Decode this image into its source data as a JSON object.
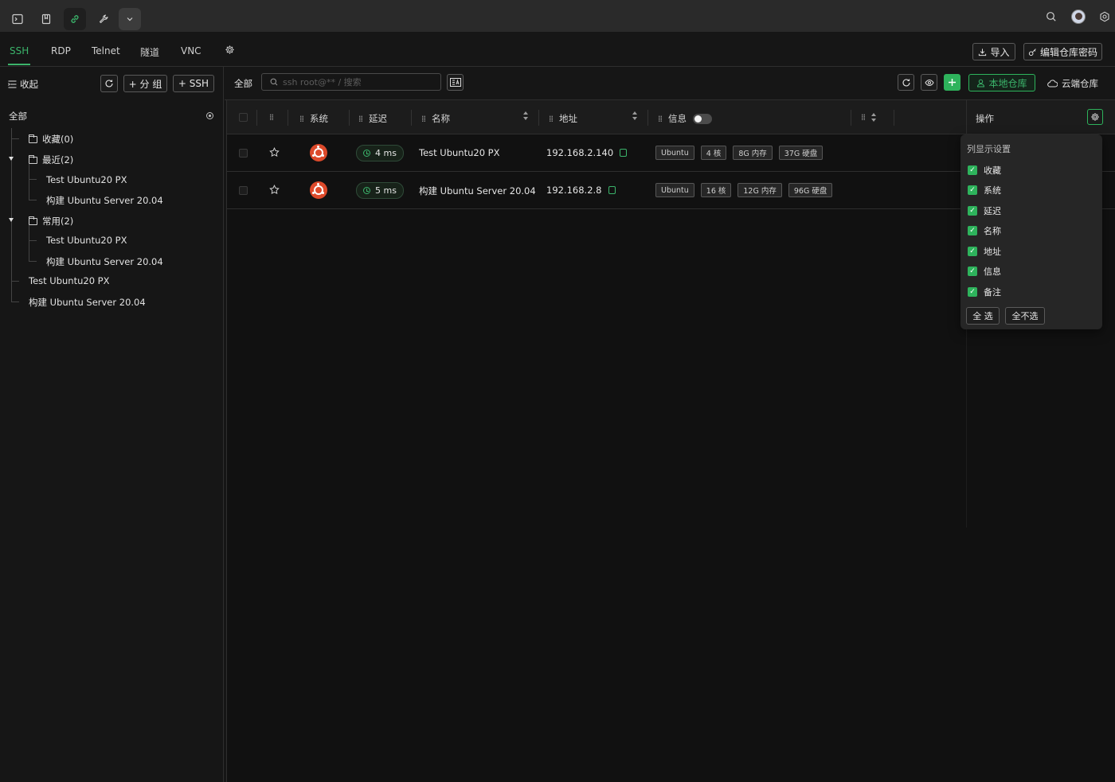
{
  "topbar": {
    "icons": [
      "terminal-icon",
      "bookmark-icon",
      "link-icon",
      "tools-icon",
      "chevron-down-icon"
    ],
    "active_icon": "link-icon",
    "right_icons": [
      "search-icon",
      "avatar",
      "settings-icon"
    ]
  },
  "tabs": [
    "SSH",
    "RDP",
    "Telnet",
    "隧道",
    "VNC"
  ],
  "active_tab": "SSH",
  "header_actions": {
    "import": "导入",
    "edit_password": "编辑仓库密码"
  },
  "sidebar": {
    "collapse": "收起",
    "add_group": "+ 分 组",
    "add_ssh": "+ SSH",
    "root": "全部",
    "tree": {
      "favorites": "收藏(0)",
      "recent": "最近(2)",
      "recent_children": [
        "Test Ubuntu20 PX",
        "构建 Ubuntu Server 20.04"
      ],
      "common": "常用(2)",
      "common_children": [
        "Test Ubuntu20 PX",
        "构建 Ubuntu Server 20.04"
      ],
      "loose": [
        "Test Ubuntu20 PX",
        "构建 Ubuntu Server 20.04"
      ]
    }
  },
  "toolbar": {
    "scope": "全部",
    "search_placeholder": "ssh root@** / 搜索",
    "local_repo": "本地仓库",
    "cloud_repo": "云端仓库"
  },
  "table": {
    "columns": {
      "system": "系统",
      "latency": "延迟",
      "name": "名称",
      "address": "地址",
      "info": "信息",
      "actions": "操作"
    },
    "rows": [
      {
        "latency": "4 ms",
        "name": "Test Ubuntu20 PX",
        "address": "192.168.2.140",
        "tags": [
          "Ubuntu",
          "4 核",
          "8G 内存",
          "37G 硬盘"
        ]
      },
      {
        "latency": "5 ms",
        "name": "构建 Ubuntu Server 20.04",
        "address": "192.168.2.8",
        "tags": [
          "Ubuntu",
          "16 核",
          "12G 内存",
          "96G 硬盘"
        ]
      }
    ]
  },
  "column_panel": {
    "title": "列显示设置",
    "items": [
      "收藏",
      "系统",
      "延迟",
      "名称",
      "地址",
      "信息",
      "备注"
    ],
    "select_all": "全 选",
    "select_none": "全不选"
  },
  "colors": {
    "accent": "#3bb46b",
    "background": "#161616",
    "ubuntu": "#dd4a2b"
  }
}
